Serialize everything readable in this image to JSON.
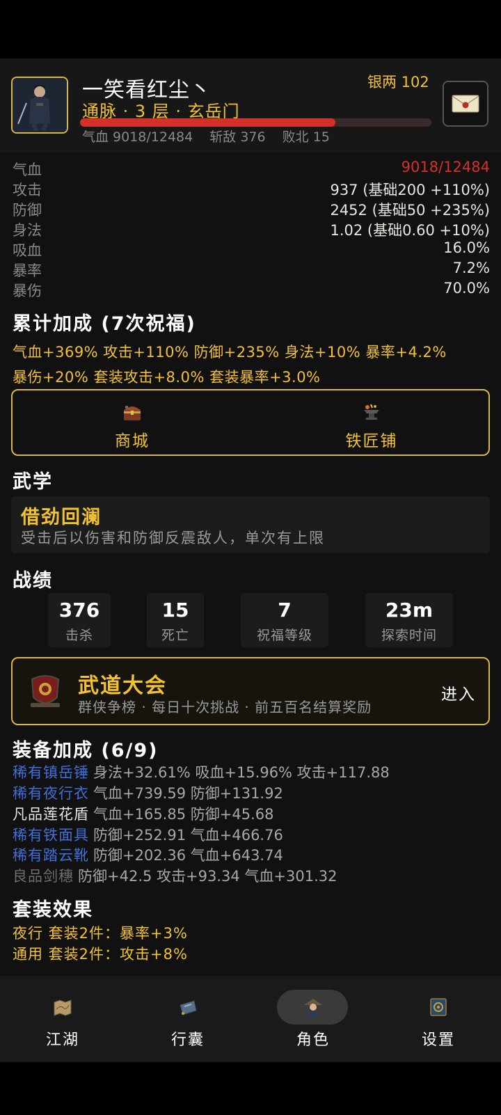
{
  "header": {
    "name": "一笑看红尘丶",
    "realm": "通脉 · 3 层 · 玄岳门",
    "silver": "银两 102",
    "hp_fraction": 0.726,
    "hp_text": "气血 9018/12484",
    "kills_text": "斩敌 376",
    "defeats_text": "败北 15"
  },
  "stats": [
    {
      "key": "气血",
      "value": "9018/12484",
      "color": "#d6302b"
    },
    {
      "key": "攻击",
      "value": "937 (基础200 +110%)"
    },
    {
      "key": "防御",
      "value": "2452 (基础50 +235%)"
    },
    {
      "key": "身法",
      "value": "1.02 (基础0.60 +10%)"
    },
    {
      "key": "吸血",
      "value": "16.0%"
    },
    {
      "key": "暴率",
      "value": "7.2%"
    },
    {
      "key": "暴伤",
      "value": "70.0%"
    }
  ],
  "bonus": {
    "title": "累计加成 (7次祝福)",
    "line1": "气血+369%  攻击+110%  防御+235%  身法+10%  暴率+4.2%",
    "line2": "暴伤+20%  套装攻击+8.0%  套装暴率+3.0%"
  },
  "shops": {
    "mall_label": "商城",
    "smith_label": "铁匠铺",
    "mall_icon": "treasure-chest-icon",
    "smith_icon": "anvil-icon"
  },
  "martial": {
    "title": "武学",
    "skill_name": "借劲回澜",
    "skill_desc": "受击后以伤害和防御反震敌人，单次有上限"
  },
  "record": {
    "title": "战绩",
    "items": [
      {
        "value": "376",
        "label": "击杀"
      },
      {
        "value": "15",
        "label": "死亡"
      },
      {
        "value": "7",
        "label": "祝福等级"
      },
      {
        "value": "23m",
        "label": "探索时间"
      }
    ]
  },
  "arena": {
    "title": "武道大会",
    "desc": "群侠争榜 · 每日十次挑战 · 前五百名结算奖励",
    "enter": "进入"
  },
  "equipment": {
    "title": "装备加成 (6/9)",
    "items": [
      {
        "name": "稀有镇岳锤",
        "bonus": "身法+32.61% 吸血+15.96% 攻击+117.88",
        "color": "#3f6fd8"
      },
      {
        "name": "稀有夜行衣",
        "bonus": "气血+739.59 防御+131.92",
        "color": "#3f6fd8"
      },
      {
        "name": "凡品莲花盾",
        "bonus": "气血+165.85 防御+45.68",
        "color": "#e8e6e1"
      },
      {
        "name": "稀有铁面具",
        "bonus": "防御+252.91 气血+466.76",
        "color": "#3f6fd8"
      },
      {
        "name": "稀有踏云靴",
        "bonus": "防御+202.36 气血+643.74",
        "color": "#3f6fd8"
      },
      {
        "name": "良品剑穗",
        "bonus": "防御+42.5 攻击+93.34 气血+301.32",
        "color": "#6e6e6e"
      }
    ]
  },
  "sets": {
    "title": "套装效果",
    "lines": [
      "夜行 套装2件：暴率+3%",
      "通用 套装2件：攻击+8%"
    ]
  },
  "nav": {
    "items": [
      {
        "label": "江湖",
        "icon": "world-map-icon"
      },
      {
        "label": "行囊",
        "icon": "bag-icon"
      },
      {
        "label": "角色",
        "icon": "character-icon"
      },
      {
        "label": "设置",
        "icon": "settings-book-icon"
      }
    ],
    "active_index": 2
  }
}
